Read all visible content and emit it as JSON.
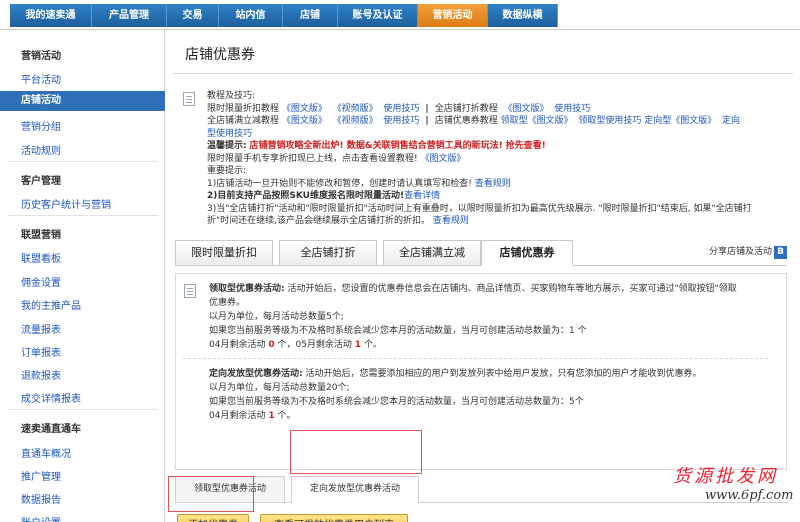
{
  "nav": {
    "tabs": [
      "我的速卖通",
      "产品管理",
      "交易",
      "站内信",
      "店铺",
      "账号及认证",
      "营销活动",
      "数据纵横"
    ],
    "active_tab": "营销活动"
  },
  "sidebar": {
    "sections": [
      {
        "title": "营销活动",
        "items": [
          "平台活动",
          "店铺活动",
          "营销分组",
          "活动规则"
        ]
      },
      {
        "title": "客户管理",
        "items": [
          "历史客户统计与营销"
        ]
      },
      {
        "title": "联盟营销",
        "items": [
          "联盟看板",
          "佣金设置",
          "我的主推产品",
          "流量报表",
          "订单报表",
          "退款报表",
          "成交详情报表"
        ]
      },
      {
        "title": "速卖通直通车",
        "items": [
          "直通车概况",
          "推广管理",
          "数据报告",
          "账户设置"
        ]
      }
    ],
    "active_item": "店铺活动"
  },
  "main": {
    "title": "店铺优惠券",
    "tutorial": {
      "heading": "教程及技巧:",
      "line1_a": "限时限量折扣教程",
      "line1_b": "《图文版》",
      "line1_c": "《视频版》",
      "line1_d": "使用技巧",
      "line1_e": "全店铺打折教程",
      "line1_f": "《图文版》",
      "line1_g": "使用技巧",
      "line2_a": "全店铺满立减教程",
      "line2_b": "《图文版》",
      "line2_c": "《视频版》",
      "line2_d": "使用技巧",
      "line2_e": "店铺优惠券教程",
      "line2_f": "领取型《图文版》",
      "line2_g": "领取型使用技巧",
      "line2_h": "定向型《图文版》",
      "line2_i": "定向",
      "line3": "型使用技巧",
      "warm_label": "温馨提示:",
      "warm_text": "店铺营销攻略全新出炉! 数据&关联销售结合营销工具的新玩法!",
      "warm_link": "抢先查看!",
      "mobile_text": "限时限量手机专享折扣现已上线，点击查看设置教程!",
      "mobile_link": "《图文版》",
      "important": "重要提示:",
      "tip1": "1)店铺活动一旦开始则不能修改和暂停，创建时请认真填写和检查!",
      "tip1_link": "查看规则",
      "tip2": "2)目前支持产品按照SKU维度报名限时限量活动!",
      "tip2_link": "查看详情",
      "tip3a": "3)当\"全店铺打折\"活动和\"限时限量折扣\"活动时间上有重叠时，以限时限量折扣为最高优先级展示. \"限时限量折扣\"结束后, 如果\"全店铺打",
      "tip3b": "折\"时间还在继续,该产品会继续展示全店铺打折的折扣。",
      "tip3_link": "查看规则"
    },
    "tabs": [
      "限时限量折扣",
      "全店铺打折",
      "全店铺满立减",
      "店铺优惠券"
    ],
    "active_tab": "店铺优惠券",
    "share": "分享店铺及活动",
    "share_badge": "B",
    "desc": {
      "claim_title": "领取型优惠券活动:",
      "claim_text": "活动开始后，您设置的优惠券信息会在店铺内、商品详情页、买家购物车等地方展示，买家可通过\"领取按钮\"领取",
      "claim_text2": "优惠券。",
      "claim_monthly": "以月为单位，每月活动总数量5个;",
      "claim_note": "如果您当前服务等级为不及格时系统会减少您本月的活动数量，当月可创建活动总数量为：1 个",
      "claim_remain_a": "04月剩余活动",
      "claim_remain_n1": "0",
      "claim_remain_b": "个，05月剩余活动",
      "claim_remain_n2": "1",
      "claim_remain_c": "个。",
      "target_title": "定向发放型优惠券活动:",
      "target_text": "活动开始后，您需要添加相应的用户到发放列表中给用户发放，只有您添加的用户才能收到优惠券。",
      "target_monthly": "以月为单位，每月活动总数量20个;",
      "target_note": "如果您当前服务等级为不及格时系统会减少您本月的活动数量，当月可创建活动总数量为：5个",
      "target_remain_a": "04月剩余活动",
      "target_remain_n": "1",
      "target_remain_b": "个。"
    },
    "subtabs": [
      "领取型优惠券活动",
      "定向发放型优惠券活动"
    ],
    "active_subtab": "定向发放型优惠券活动",
    "buttons": {
      "add": "添加优惠券",
      "view": "查看可发放优惠券用户列表"
    }
  },
  "watermark": {
    "text": "货源批发网",
    "url": "www.6pf.com"
  },
  "colors": {
    "nav_blue": "#1f5f9e",
    "nav_active": "#de7b15",
    "link": "#1c55c0",
    "alert_red": "#d21e1e",
    "highlight": "#e05252",
    "button_yellow": "#f7c440"
  }
}
